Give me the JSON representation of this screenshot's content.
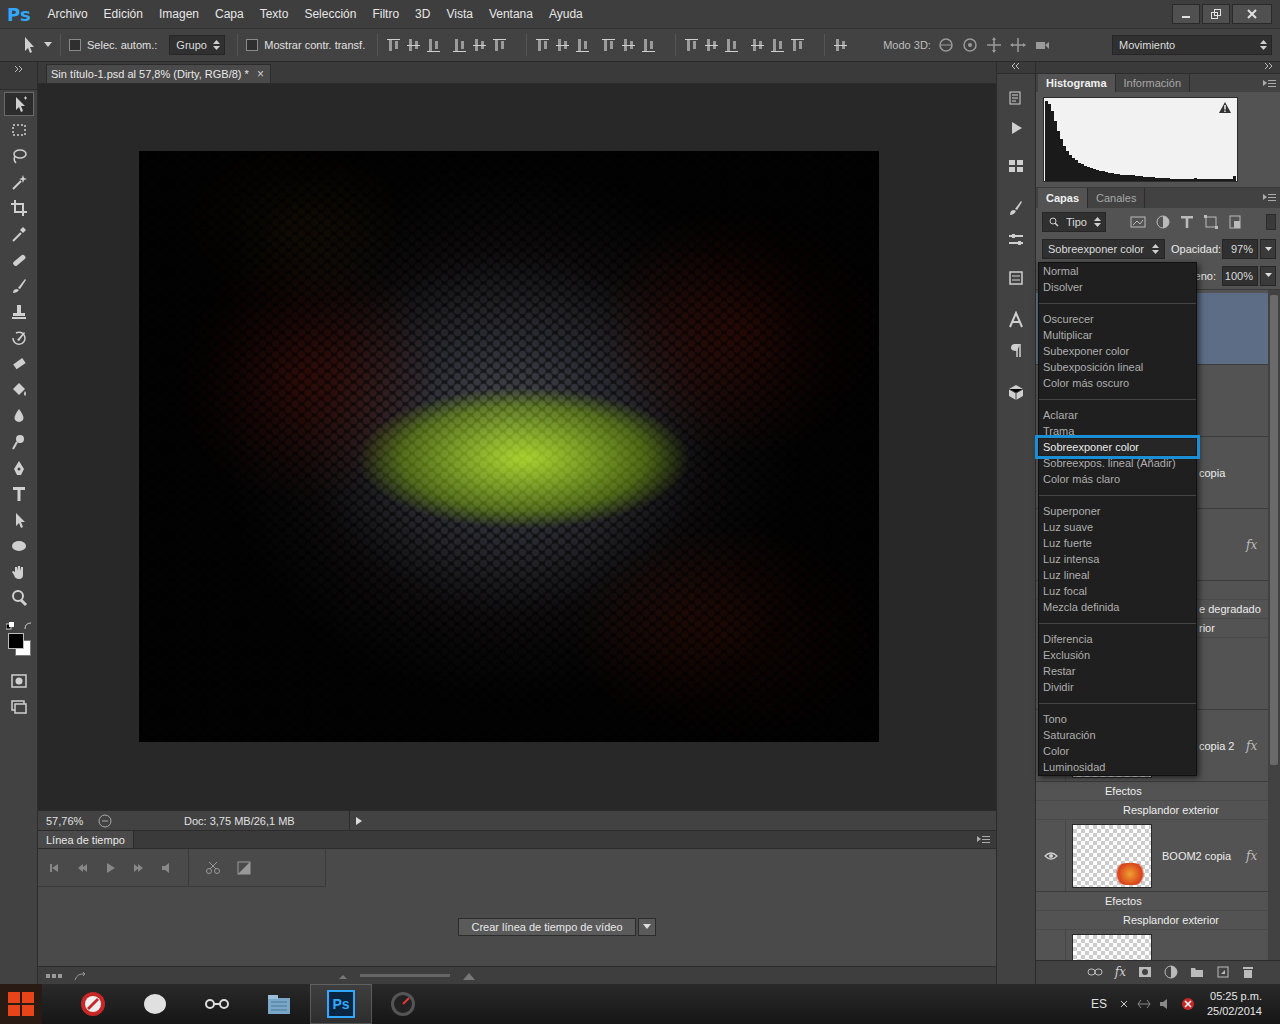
{
  "app": {
    "logo": "Ps"
  },
  "menu_bar": {
    "items": [
      "Archivo",
      "Edición",
      "Imagen",
      "Capa",
      "Texto",
      "Selección",
      "Filtro",
      "3D",
      "Vista",
      "Ventana",
      "Ayuda"
    ]
  },
  "options_bar": {
    "auto_select": {
      "label": "Selec. autom.:",
      "checked": false
    },
    "auto_select_target": "Grupo",
    "show_transform": {
      "label": "Mostrar contr. transf.",
      "checked": false
    },
    "mode_3d_label": "Modo 3D:",
    "workspace": "Movimiento"
  },
  "tools": [
    {
      "kind": "move",
      "selected": true
    },
    {
      "kind": "marquee",
      "selected": false
    },
    {
      "kind": "lasso",
      "selected": false
    },
    {
      "kind": "wand",
      "selected": false
    },
    {
      "kind": "crop",
      "selected": false
    },
    {
      "kind": "eyedropper",
      "selected": false
    },
    {
      "kind": "healing",
      "selected": false
    },
    {
      "kind": "brush",
      "selected": false
    },
    {
      "kind": "stamp",
      "selected": false
    },
    {
      "kind": "history",
      "selected": false
    },
    {
      "kind": "eraser",
      "selected": false
    },
    {
      "kind": "bucket",
      "selected": false
    },
    {
      "kind": "blur",
      "selected": false
    },
    {
      "kind": "dodge",
      "selected": false
    },
    {
      "kind": "pen",
      "selected": false
    },
    {
      "kind": "type",
      "selected": false
    },
    {
      "kind": "pathselect",
      "selected": false
    },
    {
      "kind": "shape",
      "selected": false
    },
    {
      "kind": "hand",
      "selected": false
    },
    {
      "kind": "zoom",
      "selected": false
    }
  ],
  "document": {
    "tab_title": "Sin título-1.psd al 57,8% (Dirty, RGB/8) *",
    "tab_close": "×",
    "zoom": "57,76%",
    "doc_size": "Doc: 3,75 MB/26,1 MB"
  },
  "timeline": {
    "title": "Línea de tiempo",
    "create_button": "Crear línea de tiempo de vídeo"
  },
  "histogram": {
    "tabs": [
      {
        "label": "Histograma",
        "selected": true
      },
      {
        "label": "Información",
        "selected": false
      }
    ],
    "values": [
      100,
      96,
      88,
      75,
      62,
      52,
      44,
      38,
      33,
      29,
      26,
      23,
      21,
      19,
      17,
      16,
      15,
      14,
      13,
      12,
      11,
      10,
      10,
      9,
      9,
      8,
      8,
      7,
      7,
      7,
      6,
      6,
      6,
      5,
      5,
      5,
      5,
      4,
      4,
      4,
      4,
      4,
      3,
      3,
      3,
      3,
      3,
      3,
      3,
      3,
      4,
      3,
      3,
      3,
      3,
      3,
      2,
      2,
      2,
      2,
      2,
      2,
      3,
      6
    ]
  },
  "layers_panel": {
    "tabs": [
      {
        "label": "Capas",
        "selected": true
      },
      {
        "label": "Canales",
        "selected": false
      }
    ],
    "filter": "Tipo",
    "blend_mode": "Sobreexponer color",
    "opacity_label": "Opacidad:",
    "opacity": "97%",
    "fill_label": "eno:",
    "fill": "100%",
    "footer_fx": "fx",
    "layers": [
      {
        "selected": true,
        "visible": true
      },
      {
        "selected": false,
        "visible": true
      },
      {
        "name": "copia",
        "selected": false,
        "visible": true
      },
      {
        "fx": "fx",
        "selected": false,
        "visible": true,
        "effects": [
          "e degradado",
          "rior"
        ]
      },
      {
        "selected": false,
        "visible": true
      },
      {
        "name": "copia 2",
        "fx": "fx",
        "selected": false,
        "visible": true,
        "effects_header": "Efectos",
        "effects": [
          "Resplandor exterior"
        ]
      },
      {
        "name": "BOOM2 copia",
        "fx": "fx",
        "selected": false,
        "visible": true,
        "effects_header": "Efectos",
        "effects": [
          "Resplandor exterior"
        ]
      },
      {
        "selected": false,
        "visible": true
      }
    ]
  },
  "blend_menu": {
    "groups": [
      [
        {
          "label": "Normal",
          "selected": false
        },
        {
          "label": "Disolver",
          "selected": false
        }
      ],
      [
        {
          "label": "Oscurecer",
          "selected": false
        },
        {
          "label": "Multiplicar",
          "selected": false
        },
        {
          "label": "Subexponer color",
          "selected": false
        },
        {
          "label": "Subexposición lineal",
          "selected": false
        },
        {
          "label": "Color más oscuro",
          "selected": false
        }
      ],
      [
        {
          "label": "Aclarar",
          "selected": false
        },
        {
          "label": "Trama",
          "selected": false
        },
        {
          "label": "Sobreexponer color",
          "selected": true
        },
        {
          "label": "Sobreexpos. lineal (Añadir)",
          "selected": false
        },
        {
          "label": "Color más claro",
          "selected": false
        }
      ],
      [
        {
          "label": "Superponer",
          "selected": false
        },
        {
          "label": "Luz suave",
          "selected": false
        },
        {
          "label": "Luz fuerte",
          "selected": false
        },
        {
          "label": "Luz intensa",
          "selected": false
        },
        {
          "label": "Luz lineal",
          "selected": false
        },
        {
          "label": "Luz focal",
          "selected": false
        },
        {
          "label": "Mezcla definida",
          "selected": false
        }
      ],
      [
        {
          "label": "Diferencia",
          "selected": false
        },
        {
          "label": "Exclusión",
          "selected": false
        },
        {
          "label": "Restar",
          "selected": false
        },
        {
          "label": "Dividir",
          "selected": false
        }
      ],
      [
        {
          "label": "Tono",
          "selected": false
        },
        {
          "label": "Saturación",
          "selected": false
        },
        {
          "label": "Color",
          "selected": false
        },
        {
          "label": "Luminosidad",
          "selected": false
        }
      ]
    ]
  },
  "taskbar": {
    "apps": [
      {
        "kind": "game",
        "selected": false
      },
      {
        "kind": "chat",
        "selected": false
      },
      {
        "kind": "network",
        "selected": false
      },
      {
        "kind": "explorer",
        "selected": false
      },
      {
        "kind": "photoshop",
        "label": "Ps",
        "selected": true
      },
      {
        "kind": "speed",
        "selected": false
      }
    ],
    "language": "ES",
    "time": "05:25 p.m.",
    "date": "25/02/2014"
  }
}
